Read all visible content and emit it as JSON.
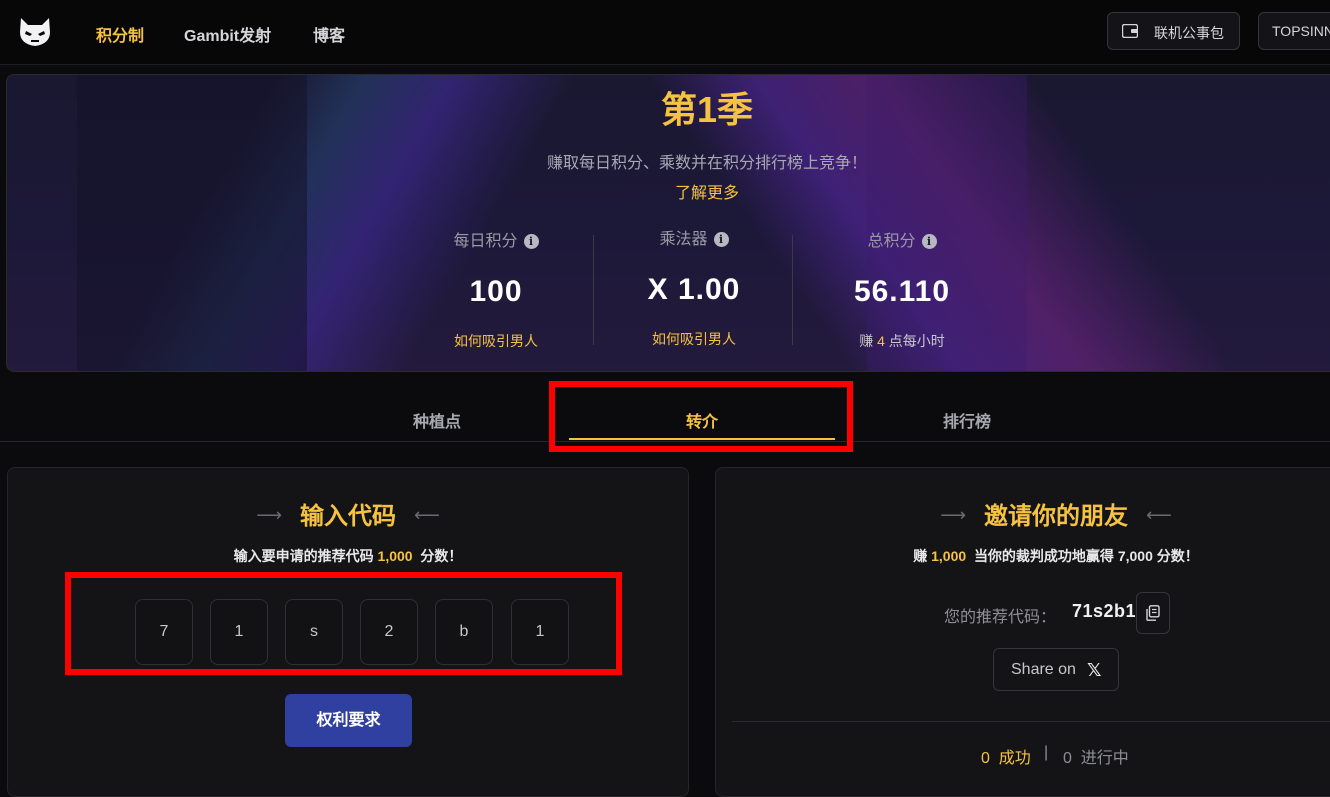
{
  "nav": {
    "links": [
      "积分制",
      "Gambit发射",
      "博客"
    ],
    "wallet_label": "联机公事包",
    "account_label": "TOPSINNER"
  },
  "hero": {
    "title": "第1季",
    "subtitle": "赚取每日积分、乘数并在积分排行榜上竞争！",
    "learn_more": "了解更多",
    "stats": [
      {
        "label": "每日积分",
        "value": "100",
        "footer": "如何吸引男人"
      },
      {
        "label": "乘法器",
        "value": "X 1.00",
        "footer": "如何吸引男人"
      },
      {
        "label": "总积分",
        "value": "56.110",
        "footer_prefix": "赚",
        "footer_value": "4",
        "footer_suffix": "点每小时"
      }
    ]
  },
  "tabs": [
    "种植点",
    "转介",
    "排行榜"
  ],
  "active_tab": "转介",
  "enter_code": {
    "title": "输入代码",
    "desc_prefix": "输入要申请的推荐代码",
    "desc_amount": "1,000",
    "desc_suffix": "分数！",
    "code_chars": [
      "7",
      "1",
      "s",
      "2",
      "b",
      "1"
    ],
    "claim_label": "权利要求"
  },
  "invite": {
    "title": "邀请你的朋友",
    "desc_prefix": "赚",
    "desc_amount": "1,000",
    "desc_suffix": "当你的裁判成功地赢得 7,000 分数！",
    "ref_label": "您的推荐代码：",
    "ref_code": "71s2b1",
    "share_label": "Share on",
    "share_icon": "x-logo",
    "success_count": "0",
    "success_label": "成功",
    "pending_count": "0",
    "pending_label": "进行中"
  },
  "colors": {
    "accent": "#f5c242",
    "button": "#3040a0",
    "highlight": "#ff0000",
    "background": "#0b0b0d"
  }
}
